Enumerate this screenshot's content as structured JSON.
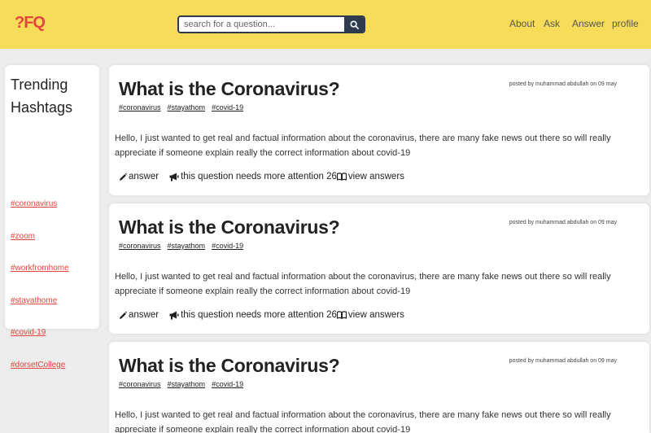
{
  "header": {
    "logo": "?FQ",
    "search": {
      "placeholder": "search for a question..."
    },
    "nav": [
      "About",
      "Ask",
      "Answer",
      "profile"
    ],
    "background": "#f7dc5a"
  },
  "sidebar": {
    "title": "Trending Hashtags",
    "tags": [
      "#coronavirus",
      "#zoom",
      "#workfromhome",
      "#stayathome",
      "#covid-19",
      "#dorsetCollege"
    ]
  },
  "questions": [
    {
      "title": "What is the Coronavirus?",
      "meta": "posted by muhammad abdullah on 09 may",
      "tags": [
        "#coronavirus",
        "#stayathom",
        "#covid-19"
      ],
      "body": "Hello, I just wanted to get real and factual information about the coronavirus, there are many fake news out there so will really appreciate if someone explain really the correct information about covid-19",
      "answer_label": "answer",
      "attention_label": "this question needs more attention 26",
      "view_label": "view answers"
    },
    {
      "title": "What is the Coronavirus?",
      "meta": "posted by muhammad abdullah on 09 may",
      "tags": [
        "#coronavirus",
        "#stayathom",
        "#covid-19"
      ],
      "body": "Hello, I just wanted to get real and factual information about the coronavirus, there are many fake news out there so will really appreciate if someone explain really the correct information about covid-19",
      "answer_label": "answer",
      "attention_label": "this question needs more attention 26",
      "view_label": "view answers"
    },
    {
      "title": "What is the Coronavirus?",
      "meta": "posted by muhammad abdullah on 09 may",
      "tags": [
        "#coronavirus",
        "#stayathom",
        "#covid-19"
      ],
      "body": "Hello, I just wanted to get real and factual information about the coronavirus, there are many fake news out there so will really appreciate if someone explain really the correct information about covid-19"
    }
  ],
  "colors": {
    "accent": "#e0463c",
    "dark": "#2f3a4f",
    "page_bg": "#ececec"
  },
  "icons": [
    "search-icon",
    "pencil-icon",
    "megaphone-icon",
    "book-icon"
  ]
}
